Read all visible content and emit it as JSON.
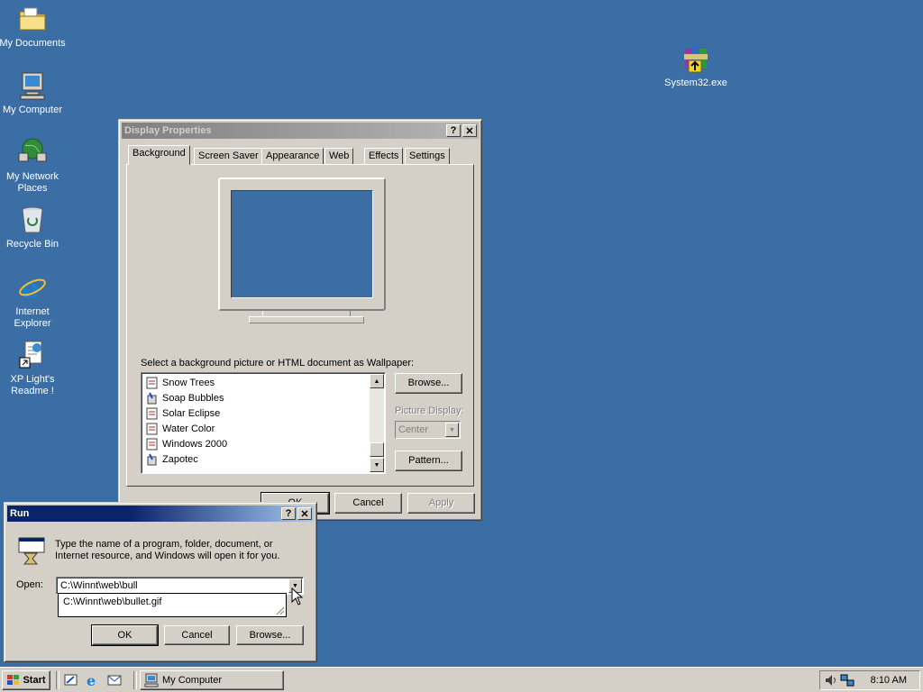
{
  "desktop": {
    "icons": [
      {
        "label": "My Documents",
        "icon": "folder-documents-icon"
      },
      {
        "label": "My Computer",
        "icon": "computer-icon"
      },
      {
        "label": "My Network Places",
        "icon": "network-places-icon"
      },
      {
        "label": "Recycle Bin",
        "icon": "recycle-bin-icon"
      },
      {
        "label": "Internet Explorer",
        "icon": "internet-explorer-icon"
      },
      {
        "label": "XP Light's Readme !",
        "icon": "shortcut-document-icon"
      },
      {
        "label": "System32.exe",
        "icon": "archive-exe-icon"
      }
    ],
    "background_color": "#3a6ea5"
  },
  "display_properties": {
    "title": "Display Properties",
    "help_btn": "?",
    "close_btn": "✕",
    "tabs": [
      "Background",
      "Screen Saver",
      "Appearance",
      "Web",
      "Effects",
      "Settings"
    ],
    "active_tab": "Background",
    "prompt": "Select a background picture or HTML document as Wallpaper:",
    "wallpapers": [
      "Snow Trees",
      "Soap Bubbles",
      "Solar Eclipse",
      "Water Color",
      "Windows 2000",
      "Zapotec"
    ],
    "browse": "Browse...",
    "picture_display_label": "Picture Display:",
    "picture_display_value": "Center",
    "pattern": "Pattern...",
    "ok": "OK",
    "cancel": "Cancel",
    "apply": "Apply"
  },
  "run_dialog": {
    "title": "Run",
    "help_btn": "?",
    "close_btn": "✕",
    "description": "Type the name of a program, folder, document, or Internet resource, and Windows will open it for you.",
    "open_label": "Open:",
    "open_value": "C:\\Winnt\\web\\bull",
    "autocomplete": [
      "C:\\Winnt\\web\\bullet.gif"
    ],
    "ok": "OK",
    "cancel": "Cancel",
    "browse": "Browse..."
  },
  "taskbar": {
    "start": "Start",
    "quick_launch": [
      "show-desktop-icon",
      "internet-explorer-icon",
      "outlook-express-icon"
    ],
    "tasks": [
      {
        "label": "My Computer",
        "icon": "computer-icon"
      }
    ],
    "tray_icons": [
      "volume-icon",
      "network-icon"
    ],
    "clock": "8:10 AM"
  }
}
